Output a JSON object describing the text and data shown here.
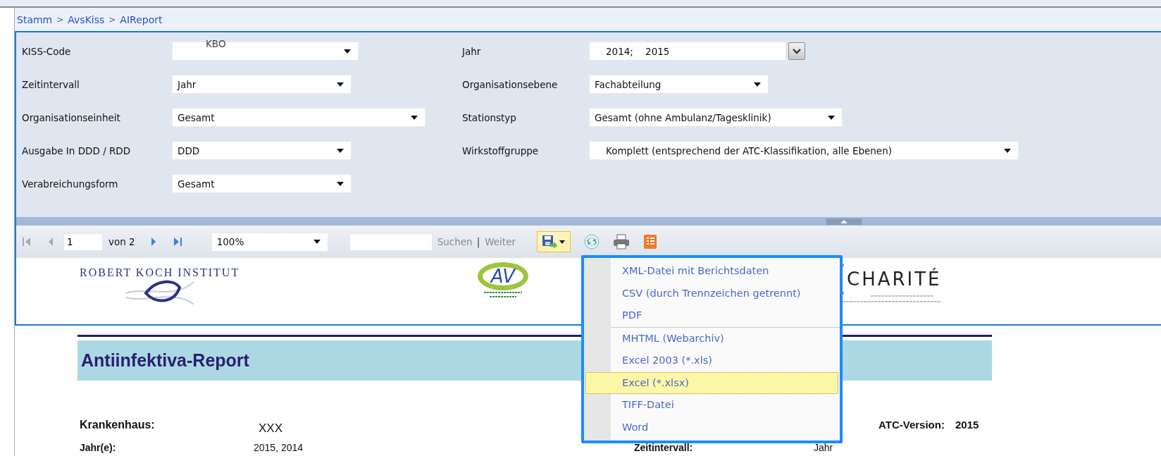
{
  "breadcrumb": {
    "separator": ">",
    "items": [
      "Stamm",
      "AvsKiss",
      "AIReport"
    ]
  },
  "params": {
    "left": [
      {
        "label": "KISS-Code",
        "value": "KBO",
        "kind": "dropdown"
      },
      {
        "label": "Zeitintervall",
        "value": "Jahr",
        "kind": "dropdown"
      },
      {
        "label": "Organisationseinheit",
        "value": "Gesamt",
        "kind": "dropdown"
      },
      {
        "label": "Ausgabe In DDD / RDD",
        "value": "DDD",
        "kind": "dropdown"
      },
      {
        "label": "Verabreichungsform",
        "value": "Gesamt",
        "kind": "dropdown"
      }
    ],
    "right": [
      {
        "label": "Jahr",
        "value": "2014;    2015",
        "kind": "multiselect"
      },
      {
        "label": "Organisationsebene",
        "value": "Fachabteilung",
        "kind": "dropdown"
      },
      {
        "label": "Stationstyp",
        "value": "Gesamt (ohne Ambulanz/Tagesklinik)",
        "kind": "dropdown"
      },
      {
        "label": "Wirkstoffgruppe",
        "value": "Komplett (entsprechend der ATC-Klassifikation, alle Ebenen)",
        "kind": "dropdown"
      }
    ]
  },
  "toolbar": {
    "nav": [
      {
        "kind": "first",
        "disabled": true
      },
      {
        "kind": "prev",
        "disabled": true
      }
    ],
    "nav_after": [
      {
        "kind": "next",
        "disabled": false
      },
      {
        "kind": "last",
        "disabled": false
      }
    ],
    "page": "1",
    "page_count": "von 2",
    "zoom": "100%",
    "find": "Suchen",
    "find_separator": "|",
    "find_next": "Weiter",
    "find_disabled": true,
    "export_open": true
  },
  "export_menu": {
    "groups": [
      [
        {
          "label": "XML-Datei mit Berichtsdaten",
          "selected": false
        },
        {
          "label": "CSV (durch Trennzeichen getrennt)",
          "selected": false
        },
        {
          "label": "PDF",
          "selected": false
        }
      ],
      [
        {
          "label": "MHTML (Webarchiv)",
          "selected": false
        },
        {
          "label": "Excel 2003 (*.xls)",
          "selected": false
        },
        {
          "label": "Excel (*.xlsx)",
          "selected": true
        },
        {
          "label": "TIFF-Datei",
          "selected": false
        },
        {
          "label": "Word",
          "selected": false
        }
      ]
    ]
  },
  "logos": [
    {
      "kind": "rki",
      "text": "ROBERT KOCH INSTITUT"
    },
    {
      "kind": "av",
      "text": "AV"
    },
    {
      "kind": "charite",
      "text": "CHARITÉ"
    }
  ],
  "report": {
    "title": "Antiinfektiva-Report",
    "rows": [
      {
        "left": {
          "label": "Krankenhaus:",
          "value": "XXX"
        },
        "right": {
          "label": "ATC-Version:",
          "value": "2015"
        }
      },
      {
        "left": {
          "label": "Jahr(e):",
          "value": "2015, 2014"
        },
        "right": {
          "label": "Zeitintervall:",
          "value": "Jahr"
        }
      }
    ]
  }
}
